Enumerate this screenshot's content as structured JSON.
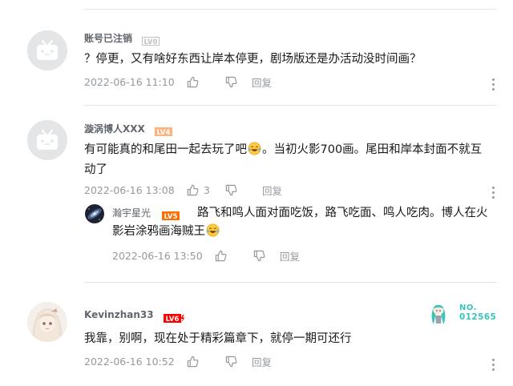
{
  "comments": [
    {
      "username": "账号已注销",
      "level": "LV0",
      "content": "？停更，又有啥好东西让岸本停更，剧场版还是办活动没时间画？",
      "time": "2022-06-16 11:10",
      "like_count": "",
      "reply_label": "回复"
    },
    {
      "username": "漩涡博人XXX",
      "level": "LV4",
      "content_line1_before_emoji": "有可能真的和尾田一起去玩了吧",
      "content_line1_after_emoji": "。当初火影700画。尾田和岸本封面不就互",
      "content_line2": "动了",
      "time": "2022-06-16 13:08",
      "like_count": "3",
      "reply_label": "回复",
      "replies": [
        {
          "username": "瀚宇星光",
          "level": "LV5",
          "content_line1": "路飞和鸣人面对面吃饭，路飞吃面、鸣人吃肉。博人在火",
          "content_line2_before_emoji": "影岩涂鸦画海贼王",
          "time": "2022-06-16 13:50",
          "reply_label": "回复"
        }
      ]
    },
    {
      "username": "Kevinzhan33",
      "level": "LV6",
      "content": "我靠，别啊，现在处于精彩篇章下，就停一期可还行",
      "time": "2022-06-16 10:52",
      "like_count": "",
      "reply_label": "回复",
      "medal": {
        "label": "NO.",
        "number": "012565"
      }
    }
  ],
  "icons": {
    "like": "thumbs-up-icon",
    "dislike": "thumbs-down-icon",
    "more": "more-vertical-icon",
    "emoji": "laughing-tears-emoji"
  },
  "colors": {
    "text_primary": "#18191c",
    "text_secondary": "#61666d",
    "text_meta": "#9499a0",
    "divider": "#e3e5e7",
    "lv0": "#c0c0c0",
    "lv4": "#ffb37c",
    "lv5": "#ff6c00",
    "lv6": "#ff0000"
  }
}
